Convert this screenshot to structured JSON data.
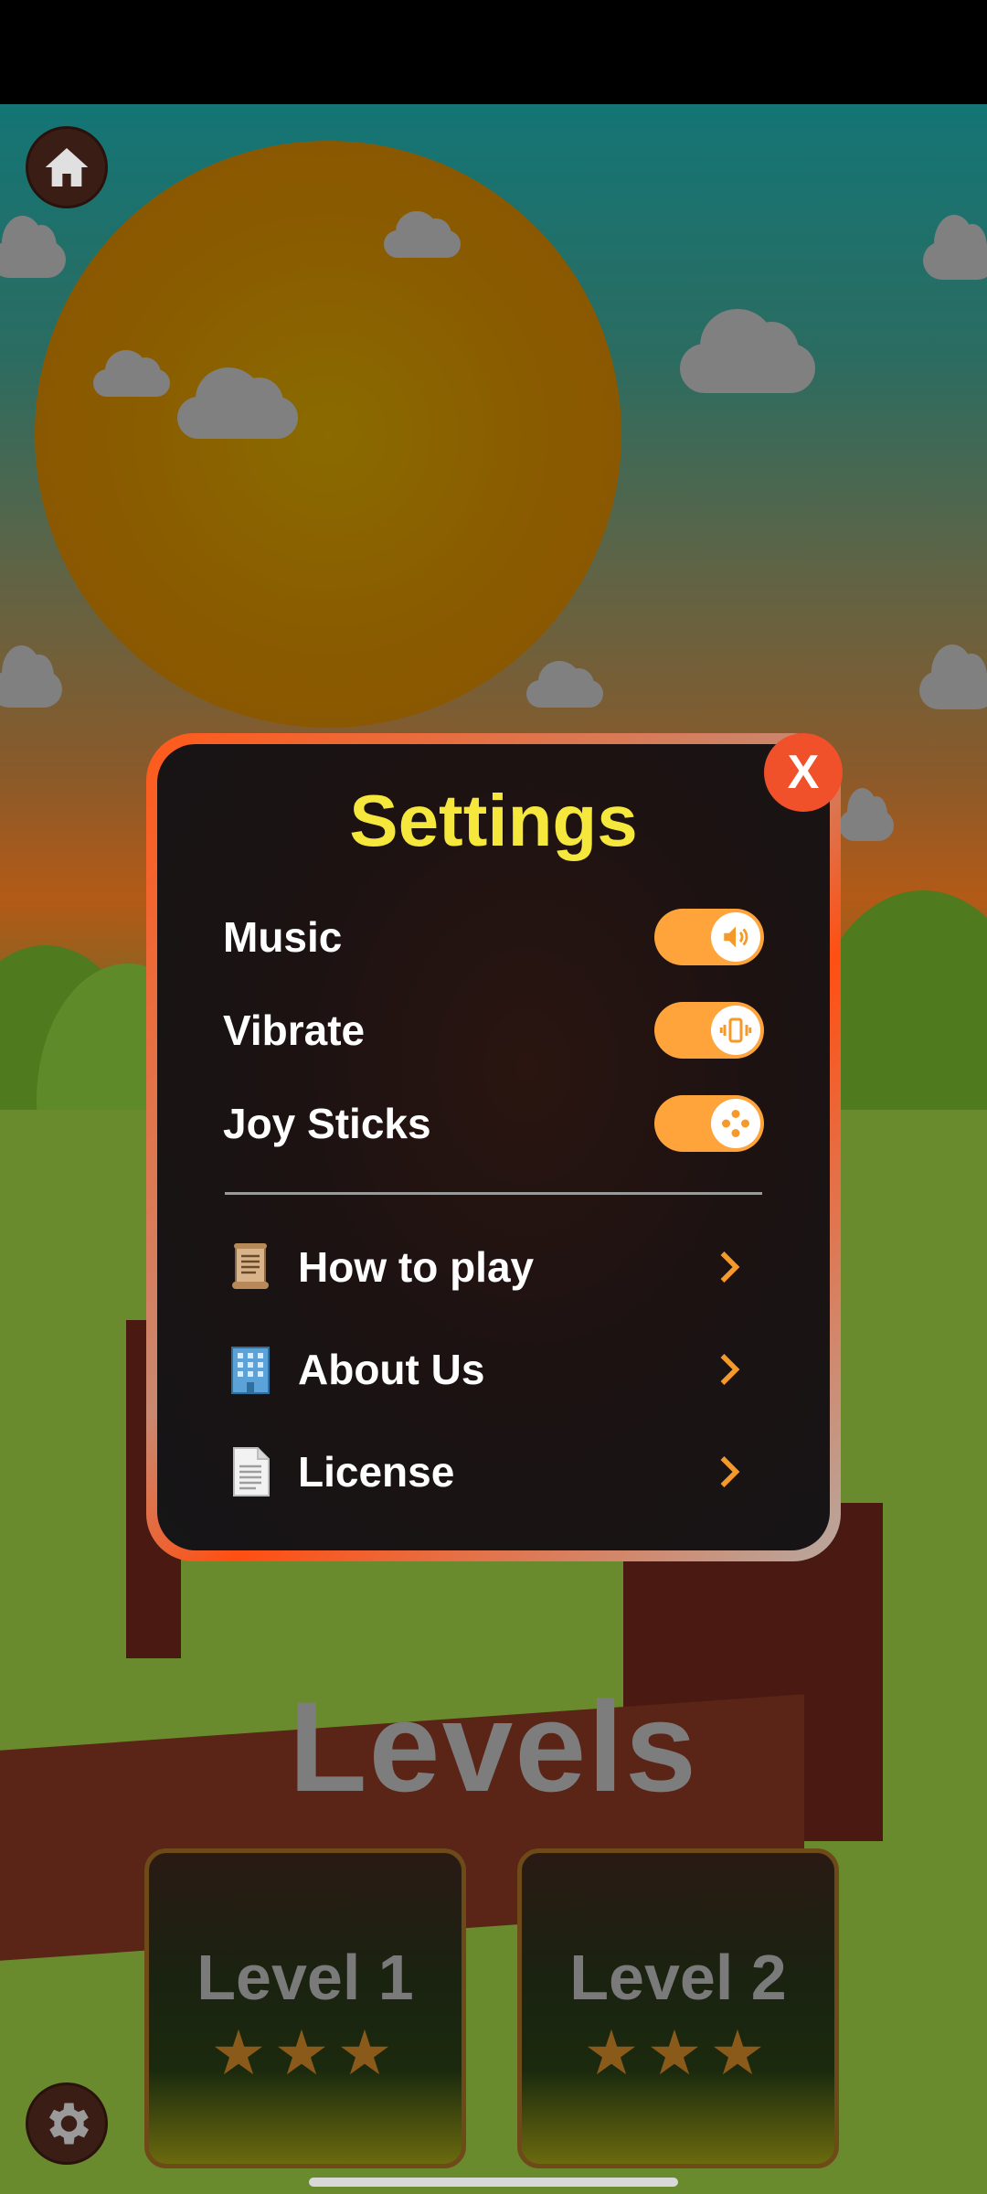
{
  "settings": {
    "title": "Settings",
    "close_label": "X",
    "toggles": [
      {
        "label": "Music",
        "on": true,
        "icon": "speaker-icon"
      },
      {
        "label": "Vibrate",
        "on": true,
        "icon": "vibrate-icon"
      },
      {
        "label": "Joy Sticks",
        "on": true,
        "icon": "gamepad-icon"
      }
    ],
    "menu": [
      {
        "label": "How to play",
        "icon": "scroll-icon"
      },
      {
        "label": "About Us",
        "icon": "building-icon"
      },
      {
        "label": "License",
        "icon": "document-icon"
      }
    ]
  },
  "levels": {
    "title": "Levels",
    "cards": [
      {
        "label": "Level 1",
        "stars": "★★★"
      },
      {
        "label": "Level 2",
        "stars": "★★★"
      }
    ]
  },
  "colors": {
    "accent": "#ffa43a",
    "title_yellow": "#f6e73d",
    "close_red": "#f1512a"
  }
}
